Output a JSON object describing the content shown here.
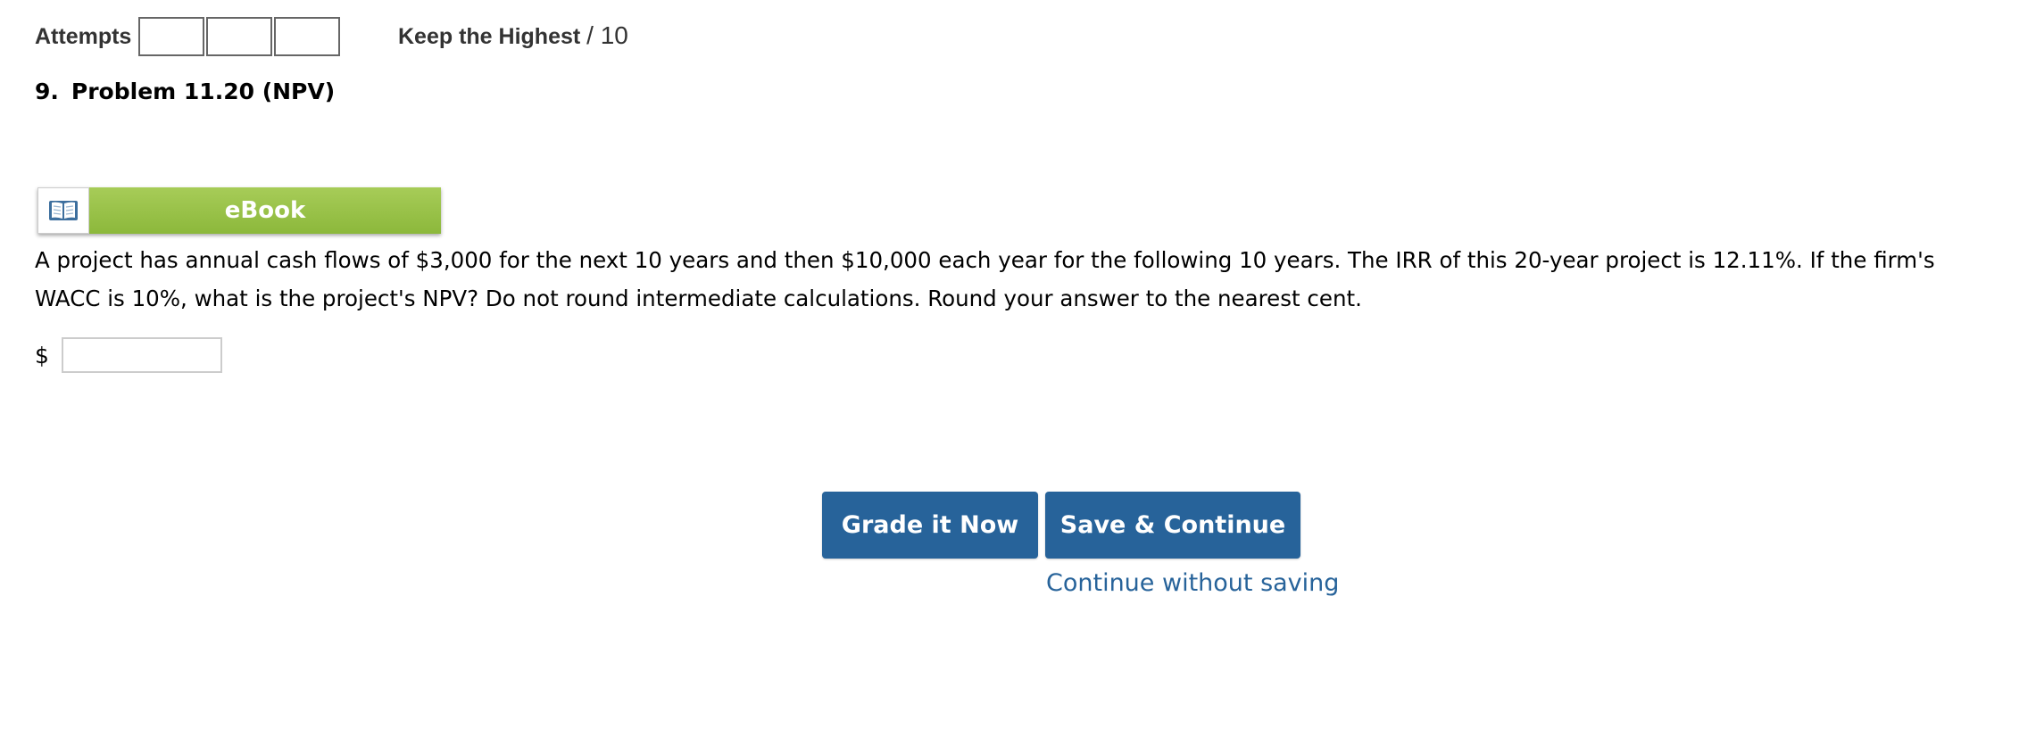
{
  "header": {
    "attempts_label": "Attempts",
    "attempt_boxes": 3,
    "keep_highest_label": "Keep the Highest",
    "score_suffix": "/ 10"
  },
  "problem": {
    "number": "9.",
    "title": "Problem 11.20 (NPV)"
  },
  "ebook": {
    "label": "eBook",
    "icon": "book-icon"
  },
  "question": {
    "text": "A project has annual cash flows of $3,000 for the next 10 years and then $10,000 each year for the following 10 years. The IRR of this 20-year project is 12.11%. If the firm's WACC is 10%, what is the project's NPV? Do not round intermediate calculations. Round your answer to the nearest cent."
  },
  "answer": {
    "prefix": "$",
    "value": "",
    "placeholder": ""
  },
  "actions": {
    "grade_label": "Grade it Now",
    "save_label": "Save & Continue",
    "continue_label": "Continue without saving"
  },
  "colors": {
    "button_blue": "#27639a",
    "ebook_green": "#98c146",
    "link_blue": "#27639a"
  }
}
